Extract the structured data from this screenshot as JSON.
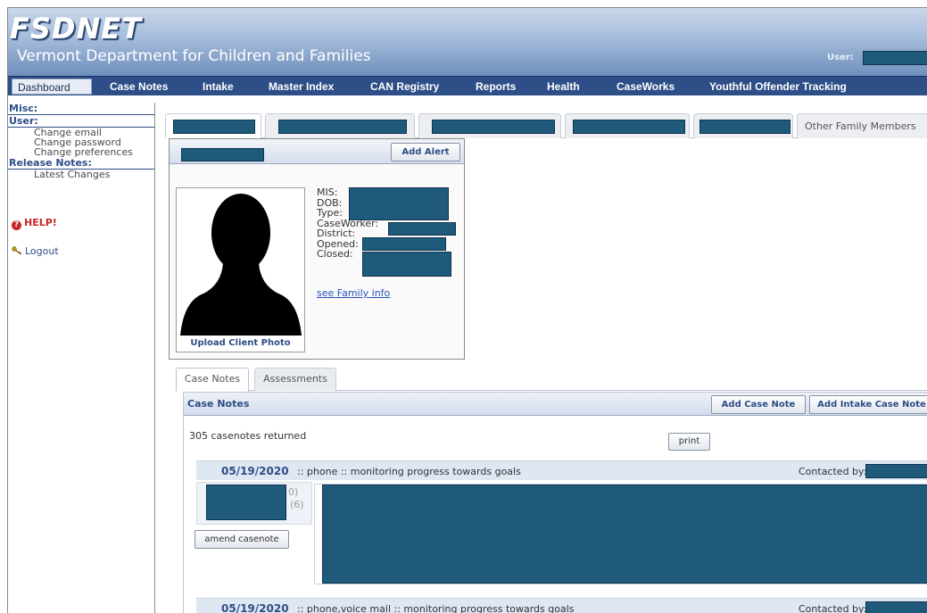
{
  "header": {
    "logo": "FSDNET",
    "subtitle": "Vermont Department for Children and Families",
    "user_label": "User:"
  },
  "nav": {
    "items": [
      {
        "label": "Dashboard",
        "active": true
      },
      {
        "label": "Case Notes"
      },
      {
        "label": "Intake"
      },
      {
        "label": "Master Index"
      },
      {
        "label": "CAN Registry"
      },
      {
        "label": "Reports"
      },
      {
        "label": "Health"
      },
      {
        "label": "CaseWorks"
      },
      {
        "label": "Youthful Offender Tracking"
      }
    ]
  },
  "sidebar": {
    "misc_heading": "Misc:",
    "user_heading": "User:",
    "user_links": [
      "Change email",
      "Change password",
      "Change preferences"
    ],
    "release_heading": "Release Notes:",
    "release_links": [
      "Latest Changes"
    ],
    "help_label": "HELP!",
    "logout_label": "Logout"
  },
  "family_tabs": {
    "last_label": "Other Family Members"
  },
  "client": {
    "add_alert_label": "Add Alert",
    "upload_photo_label": "Upload Client Photo",
    "fields": [
      "MIS:",
      "DOB:",
      "Type:",
      "CaseWorker:",
      "District:",
      "Opened:",
      "Closed:"
    ],
    "family_link": "see Family info"
  },
  "lower_tabs": [
    "Case Notes",
    "Assessments"
  ],
  "case_notes": {
    "title": "Case Notes",
    "add_case_note_label": "Add Case Note",
    "add_intake_case_note_label": "Add Intake Case Note",
    "count_text": "305 casenotes returned",
    "print_label": "print",
    "amend_label": "amend casenote",
    "notes": [
      {
        "date": "05/19/2020",
        "description": ":: phone :: monitoring progress towards goals",
        "contacted_by": "Contacted by:"
      },
      {
        "date": "05/19/2020",
        "description": ":: phone,voice mail :: monitoring progress towards goals",
        "contacted_by": "Contacted by:"
      }
    ],
    "partial_text": [
      "0)",
      "(6)"
    ]
  },
  "colors": {
    "nav_bg": "#2d4e86",
    "redaction": "#1f5a7a",
    "link": "#2851b8"
  }
}
